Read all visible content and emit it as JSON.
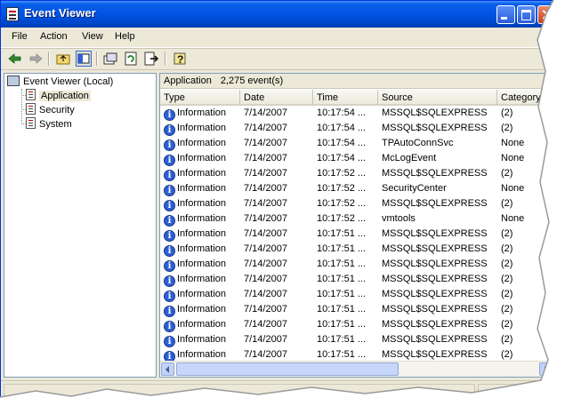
{
  "window": {
    "title": "Event Viewer"
  },
  "colors": {
    "titlebar": "#0054e3",
    "info_icon": "#2d5fd6",
    "face": "#ece9d8"
  },
  "menubar": {
    "items": [
      "File",
      "Action",
      "View",
      "Help"
    ]
  },
  "toolbar": {
    "icons": [
      "back-arrow-icon",
      "forward-arrow-icon",
      "up-folder-icon",
      "show-hide-tree-icon",
      "properties-icon",
      "refresh-icon",
      "export-list-icon",
      "help-icon"
    ]
  },
  "tree": {
    "root": "Event Viewer (Local)",
    "logs": [
      "Application",
      "Security",
      "System"
    ],
    "selected": "Application"
  },
  "pane": {
    "title": "Application",
    "count": "2,275 event(s)"
  },
  "columns": [
    "Type",
    "Date",
    "Time",
    "Source",
    "Category"
  ],
  "rows": [
    [
      "Information",
      "7/14/2007",
      "10:17:54 ...",
      "MSSQL$SQLEXPRESS",
      "(2)"
    ],
    [
      "Information",
      "7/14/2007",
      "10:17:54 ...",
      "MSSQL$SQLEXPRESS",
      "(2)"
    ],
    [
      "Information",
      "7/14/2007",
      "10:17:54 ...",
      "TPAutoConnSvc",
      "None"
    ],
    [
      "Information",
      "7/14/2007",
      "10:17:54 ...",
      "McLogEvent",
      "None"
    ],
    [
      "Information",
      "7/14/2007",
      "10:17:52 ...",
      "MSSQL$SQLEXPRESS",
      "(2)"
    ],
    [
      "Information",
      "7/14/2007",
      "10:17:52 ...",
      "SecurityCenter",
      "None"
    ],
    [
      "Information",
      "7/14/2007",
      "10:17:52 ...",
      "MSSQL$SQLEXPRESS",
      "(2)"
    ],
    [
      "Information",
      "7/14/2007",
      "10:17:52 ...",
      "vmtools",
      "None"
    ],
    [
      "Information",
      "7/14/2007",
      "10:17:51 ...",
      "MSSQL$SQLEXPRESS",
      "(2)"
    ],
    [
      "Information",
      "7/14/2007",
      "10:17:51 ...",
      "MSSQL$SQLEXPRESS",
      "(2)"
    ],
    [
      "Information",
      "7/14/2007",
      "10:17:51 ...",
      "MSSQL$SQLEXPRESS",
      "(2)"
    ],
    [
      "Information",
      "7/14/2007",
      "10:17:51 ...",
      "MSSQL$SQLEXPRESS",
      "(2)"
    ],
    [
      "Information",
      "7/14/2007",
      "10:17:51 ...",
      "MSSQL$SQLEXPRESS",
      "(2)"
    ],
    [
      "Information",
      "7/14/2007",
      "10:17:51 ...",
      "MSSQL$SQLEXPRESS",
      "(2)"
    ],
    [
      "Information",
      "7/14/2007",
      "10:17:51 ...",
      "MSSQL$SQLEXPRESS",
      "(2)"
    ],
    [
      "Information",
      "7/14/2007",
      "10:17:51 ...",
      "MSSQL$SQLEXPRESS",
      "(2)"
    ],
    [
      "Information",
      "7/14/2007",
      "10:17:51 ...",
      "MSSQL$SQLEXPRESS",
      "(2)"
    ]
  ]
}
